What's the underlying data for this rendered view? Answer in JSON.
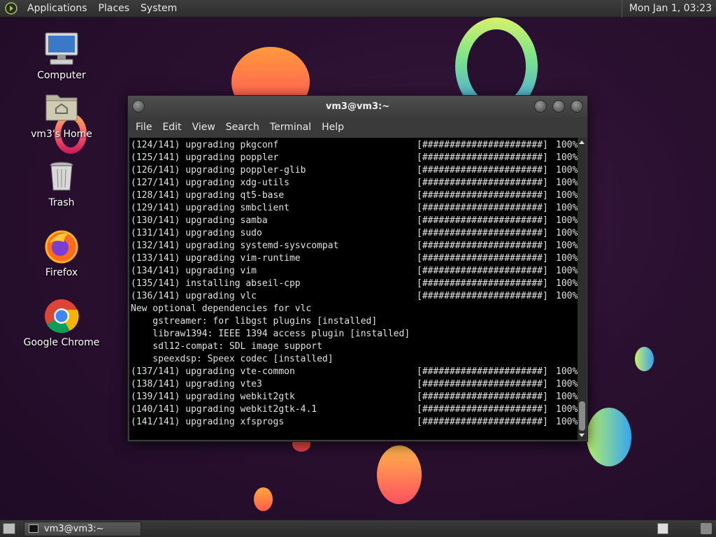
{
  "top_panel": {
    "menus": [
      "Applications",
      "Places",
      "System"
    ],
    "clock": "Mon Jan  1, 03:23"
  },
  "desktop_icons": [
    {
      "label": "Computer",
      "icon": "computer-icon"
    },
    {
      "label": "vm3's Home",
      "icon": "home-folder-icon"
    },
    {
      "label": "Trash",
      "icon": "trash-icon"
    },
    {
      "label": "Firefox",
      "icon": "firefox-icon"
    },
    {
      "label": "Google Chrome",
      "icon": "chrome-icon"
    }
  ],
  "window": {
    "title": "vm3@vm3:~",
    "menu": [
      "File",
      "Edit",
      "View",
      "Search",
      "Terminal",
      "Help"
    ]
  },
  "terminal": {
    "lines": [
      {
        "text": "(124/141) upgrading pkgconf",
        "bar": "[######################]",
        "pct": "100%"
      },
      {
        "text": "(125/141) upgrading poppler",
        "bar": "[######################]",
        "pct": "100%"
      },
      {
        "text": "(126/141) upgrading poppler-glib",
        "bar": "[######################]",
        "pct": "100%"
      },
      {
        "text": "(127/141) upgrading xdg-utils",
        "bar": "[######################]",
        "pct": "100%"
      },
      {
        "text": "(128/141) upgrading qt5-base",
        "bar": "[######################]",
        "pct": "100%"
      },
      {
        "text": "(129/141) upgrading smbclient",
        "bar": "[######################]",
        "pct": "100%"
      },
      {
        "text": "(130/141) upgrading samba",
        "bar": "[######################]",
        "pct": "100%"
      },
      {
        "text": "(131/141) upgrading sudo",
        "bar": "[######################]",
        "pct": "100%"
      },
      {
        "text": "(132/141) upgrading systemd-sysvcompat",
        "bar": "[######################]",
        "pct": "100%"
      },
      {
        "text": "(133/141) upgrading vim-runtime",
        "bar": "[######################]",
        "pct": "100%"
      },
      {
        "text": "(134/141) upgrading vim",
        "bar": "[######################]",
        "pct": "100%"
      },
      {
        "text": "(135/141) installing abseil-cpp",
        "bar": "[######################]",
        "pct": "100%"
      },
      {
        "text": "(136/141) upgrading vlc",
        "bar": "[######################]",
        "pct": "100%"
      },
      {
        "text": "New optional dependencies for vlc",
        "bar": "",
        "pct": ""
      },
      {
        "text": "    gstreamer: for libgst plugins [installed]",
        "bar": "",
        "pct": ""
      },
      {
        "text": "    libraw1394: IEEE 1394 access plugin [installed]",
        "bar": "",
        "pct": ""
      },
      {
        "text": "    sdl12-compat: SDL image support",
        "bar": "",
        "pct": ""
      },
      {
        "text": "    speexdsp: Speex codec [installed]",
        "bar": "",
        "pct": ""
      },
      {
        "text": "(137/141) upgrading vte-common",
        "bar": "[######################]",
        "pct": "100%"
      },
      {
        "text": "(138/141) upgrading vte3",
        "bar": "[######################]",
        "pct": "100%"
      },
      {
        "text": "(139/141) upgrading webkit2gtk",
        "bar": "[######################]",
        "pct": "100%"
      },
      {
        "text": "(140/141) upgrading webkit2gtk-4.1",
        "bar": "[######################]",
        "pct": "100%"
      },
      {
        "text": "(141/141) upgrading xfsprogs",
        "bar": "[######################]",
        "pct": "100%"
      }
    ]
  },
  "taskbar": {
    "task_label": "vm3@vm3:~"
  }
}
